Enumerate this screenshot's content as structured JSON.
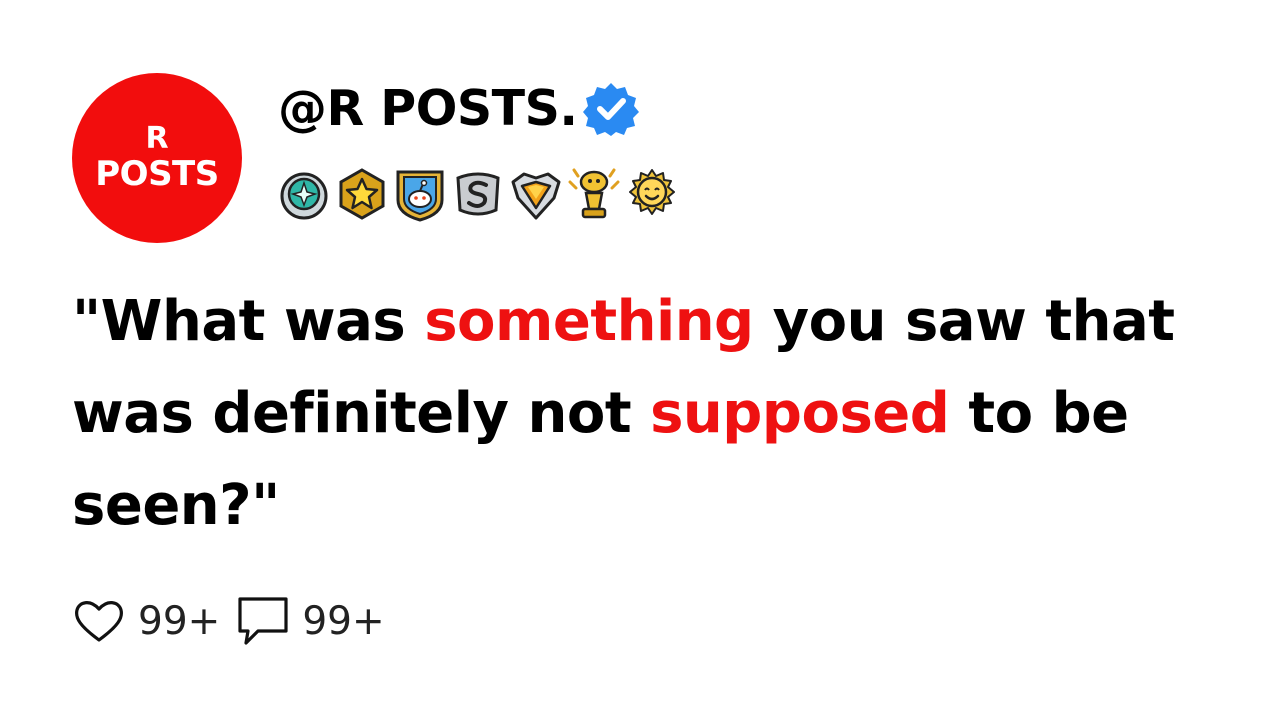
{
  "avatar": {
    "line1": "R",
    "line2": "POSTS",
    "color": "#f20d0d"
  },
  "author": {
    "handle": "@R POSTS.",
    "verified_icon": "verified-badge-icon",
    "verified_color": "#2a8af2"
  },
  "badges": [
    "gem-award-icon",
    "star-award-icon",
    "snoo-shield-award-icon",
    "silver-s-award-icon",
    "diamond-award-icon",
    "gold-trophy-award-icon",
    "sun-face-award-icon"
  ],
  "post": {
    "part1": "\"What was ",
    "highlight1": "something",
    "part2": " you saw that was definitely not ",
    "highlight2": "supposed",
    "part3": " to be seen?\"",
    "highlight_color": "#ee1111"
  },
  "stats": {
    "likes_icon": "heart-icon",
    "likes": "99+",
    "comments_icon": "comment-icon",
    "comments": "99+"
  }
}
